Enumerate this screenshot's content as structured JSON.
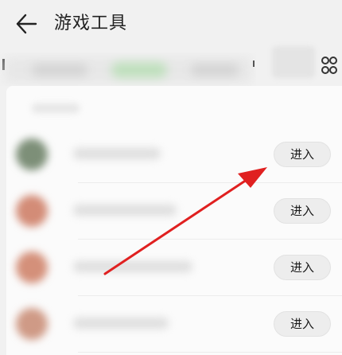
{
  "header": {
    "title": "游戏工具",
    "back_icon": "arrow-left-icon"
  },
  "toolbar": {
    "more_icon": "grid-more-icon"
  },
  "list": {
    "items": [
      {
        "enter_label": "进入",
        "avatar_color": "#7d8f78"
      },
      {
        "enter_label": "进入",
        "avatar_color": "#d38c77"
      },
      {
        "enter_label": "进入",
        "avatar_color": "#d4907a"
      },
      {
        "enter_label": "进入",
        "avatar_color": "#cf9a86"
      }
    ]
  },
  "colors": {
    "background": "#f1f1f1",
    "panel": "#fbfbfb",
    "button_bg": "#ededed",
    "arrow": "#e02020"
  }
}
